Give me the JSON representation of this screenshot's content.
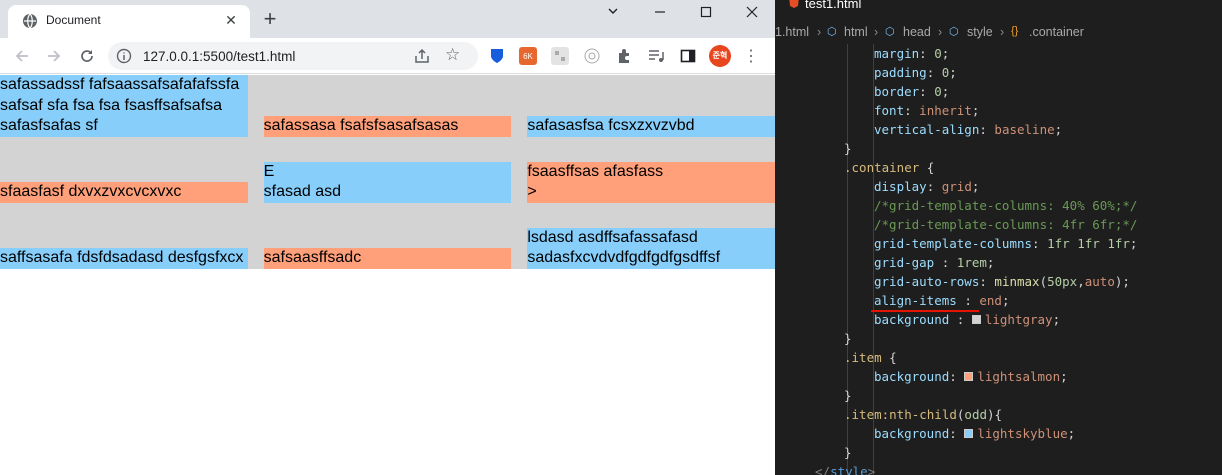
{
  "browser": {
    "tab_title": "Document",
    "url": "127.0.0.1:5500/test1.html",
    "avatar_text": "준혁",
    "ext_badge": "6K"
  },
  "grid_items": [
    [
      "safassadssf fafsaassafsafafafssfa",
      "safsaf sfa fsa fsa fsasffsafsafsa",
      "safasfsafas sf"
    ],
    [
      "safassasa fsafsfsasafsasas"
    ],
    [
      "safasasfsa fcsxzxvzvbd"
    ],
    [
      "sfaasfasf dxvxzvxcvcxvxc"
    ],
    [
      "E",
      "sfasad asd"
    ],
    [
      "fsaasffsas afasfass",
      ">"
    ],
    [
      "saffsasafa fdsfdsadasd desfgsfxcx"
    ],
    [
      "safsaasffsadc"
    ],
    [
      "lsdasd asdffsafassafasd",
      "sadasfxcvdvdfgdfgdfgsdffsf"
    ]
  ],
  "editor": {
    "tab_file": "test1.html",
    "breadcrumb": [
      "1.html",
      "html",
      "head",
      "style",
      ".container"
    ],
    "colors": {
      "lightgray": "#d3d3d3",
      "lightsalmon": "#ffa07a",
      "lightskyblue": "#87cefa"
    },
    "code_lines": [
      [
        "margin",
        "0"
      ],
      [
        "padding",
        "0"
      ],
      [
        "border",
        "0"
      ],
      [
        "font",
        "inherit"
      ],
      [
        "vertical-align",
        "baseline"
      ]
    ]
  }
}
